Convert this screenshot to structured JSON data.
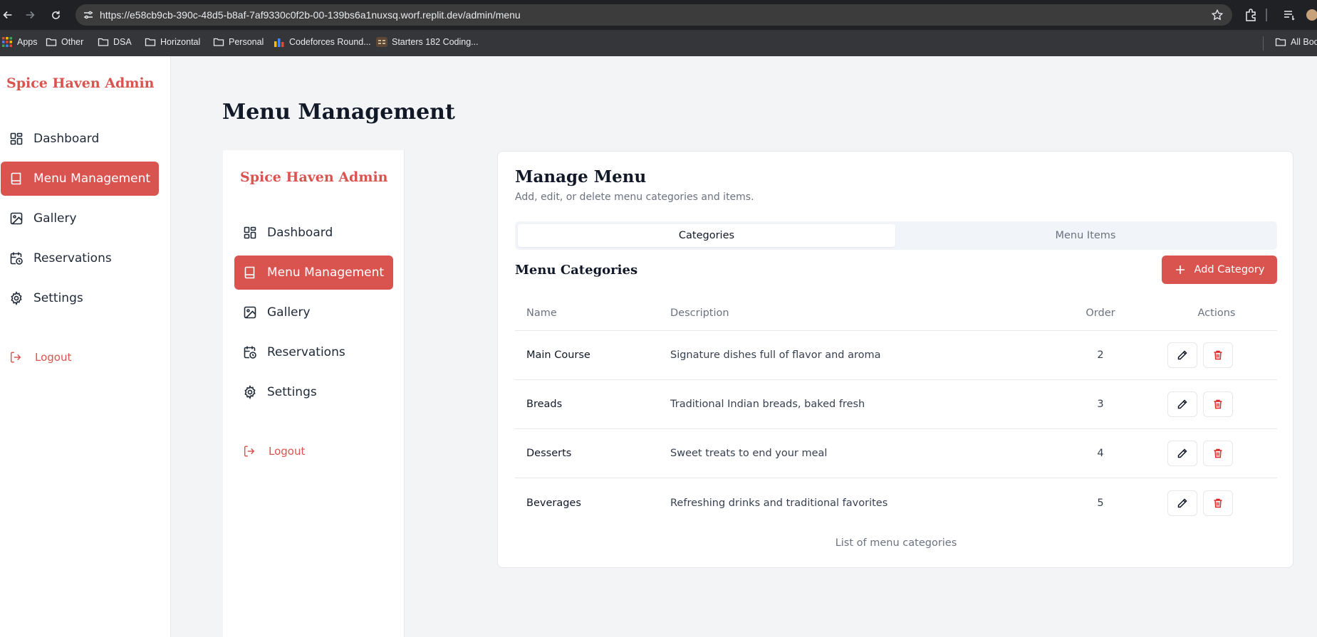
{
  "browser": {
    "url": "https://e58cb9cb-390c-48d5-b8af-7af9330c0f2b-00-139bs6a1nuxsq.worf.replit.dev/admin/menu",
    "bookmarks": [
      "Apps",
      "Other",
      "DSA",
      "Horizontal",
      "Personal",
      "Codeforces Round...",
      "Starters 182 Coding..."
    ],
    "all_bookmarks": "All Boo"
  },
  "outer_sidebar": {
    "brand": "Spice Haven Admin",
    "items": [
      {
        "label": "Dashboard",
        "icon": "dashboard-icon"
      },
      {
        "label": "Menu Management",
        "icon": "book-icon",
        "active": true
      },
      {
        "label": "Gallery",
        "icon": "image-icon"
      },
      {
        "label": "Reservations",
        "icon": "calendar-clock-icon"
      },
      {
        "label": "Settings",
        "icon": "gear-icon"
      }
    ],
    "logout": "Logout"
  },
  "page": {
    "title": "Menu Management"
  },
  "inner_sidebar": {
    "brand": "Spice Haven Admin",
    "items": [
      {
        "label": "Dashboard",
        "icon": "dashboard-icon"
      },
      {
        "label": "Menu Management",
        "icon": "book-icon",
        "active": true
      },
      {
        "label": "Gallery",
        "icon": "image-icon"
      },
      {
        "label": "Reservations",
        "icon": "calendar-clock-icon"
      },
      {
        "label": "Settings",
        "icon": "gear-icon"
      }
    ],
    "logout": "Logout"
  },
  "card": {
    "title": "Manage Menu",
    "subtitle": "Add, edit, or delete menu categories and items.",
    "tabs": [
      {
        "label": "Categories",
        "active": true
      },
      {
        "label": "Menu Items"
      }
    ],
    "section_title": "Menu Categories",
    "add_button": "Add Category",
    "table": {
      "headers": {
        "name": "Name",
        "description": "Description",
        "order": "Order",
        "actions": "Actions"
      },
      "rows": [
        {
          "name": "Main Course",
          "description": "Signature dishes full of flavor and aroma",
          "order": "2"
        },
        {
          "name": "Breads",
          "description": "Traditional Indian breads, baked fresh",
          "order": "3"
        },
        {
          "name": "Desserts",
          "description": "Sweet treats to end your meal",
          "order": "4"
        },
        {
          "name": "Beverages",
          "description": "Refreshing drinks and traditional favorites",
          "order": "5"
        }
      ],
      "caption": "List of menu categories"
    }
  },
  "colors": {
    "accent": "#d9534f",
    "background": "#f3f4f6",
    "danger": "#dc2626"
  }
}
